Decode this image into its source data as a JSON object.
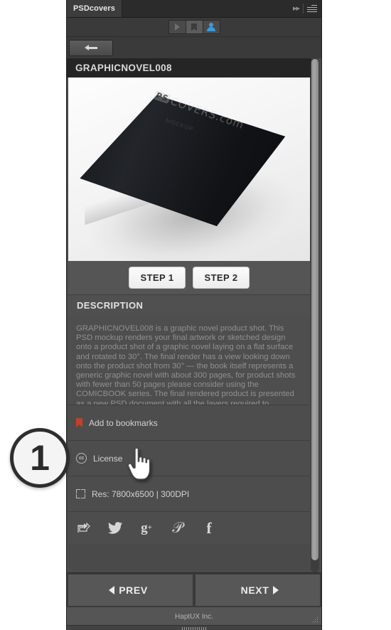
{
  "window": {
    "tab_label": "PSDcovers",
    "collapse_icon": "double-chevron-right-icon",
    "menu_icon": "panel-menu-icon"
  },
  "view_toggle": {
    "items": [
      {
        "name": "play-view",
        "icon": "play-triangle-icon",
        "active": false
      },
      {
        "name": "bookmarks-view",
        "icon": "bookmark-icon",
        "active": true
      },
      {
        "name": "account-view",
        "icon": "person-icon",
        "active": false
      }
    ]
  },
  "back_button": {
    "label": "",
    "icon": "arrow-left-icon"
  },
  "product": {
    "title": "GRAPHICNOVEL008",
    "image_alt": "black graphic novel book mockup",
    "watermark": "COVERS.com",
    "watermark_badge": "PS",
    "watermark_sub": "MOCKUP"
  },
  "steps": {
    "step1_label": "STEP 1",
    "step2_label": "STEP 2"
  },
  "description": {
    "heading": "DESCRIPTION",
    "body": "GRAPHICNOVEL008 is a graphic novel product shot. This PSD mockup renders your final artwork or sketched design onto a product shot of a graphic novel laying on a flat surface and rotated to 30°.  The final render has a view looking down onto the product shot from 30° — the book itself represents a generic graphic novel with about 300 pages, for product shots with fewer than 50 pages please consider using the COMICBOOK series. The final rendered product is presented as a new PSD document with all the layers required to manipulate the lighting, shadows and"
  },
  "meta_rows": [
    {
      "name": "add-to-bookmarks-row",
      "icon": "bookmark-icon",
      "label": "Add to bookmarks",
      "accent": "#c0412a"
    },
    {
      "name": "license-row",
      "icon": "creative-commons-icon",
      "label": "License",
      "icon_text": "cc"
    },
    {
      "name": "resolution-row",
      "icon": "crop-frame-icon",
      "label": "Res: 7800x6500 | 300DPI"
    }
  ],
  "social": [
    {
      "name": "share-icon",
      "glyph": "↪"
    },
    {
      "name": "twitter-icon",
      "glyph": "🐦"
    },
    {
      "name": "google-plus-icon",
      "glyph": "g⁺"
    },
    {
      "name": "pinterest-icon",
      "glyph": "𝒫"
    },
    {
      "name": "facebook-icon",
      "glyph": "f"
    }
  ],
  "nav": {
    "prev_label": "PREV",
    "next_label": "NEXT"
  },
  "footer": {
    "text": "HaptUX Inc."
  },
  "annotation": {
    "step_badge": "1"
  },
  "colors": {
    "panel_bg": "#3a3a3a",
    "row_bg": "#4d4d4d",
    "title_bar": "#252525",
    "accent_red": "#c0412a",
    "accent_blue": "#3a9bdc",
    "text_light": "#d2d2d2",
    "text_muted": "#909090"
  }
}
